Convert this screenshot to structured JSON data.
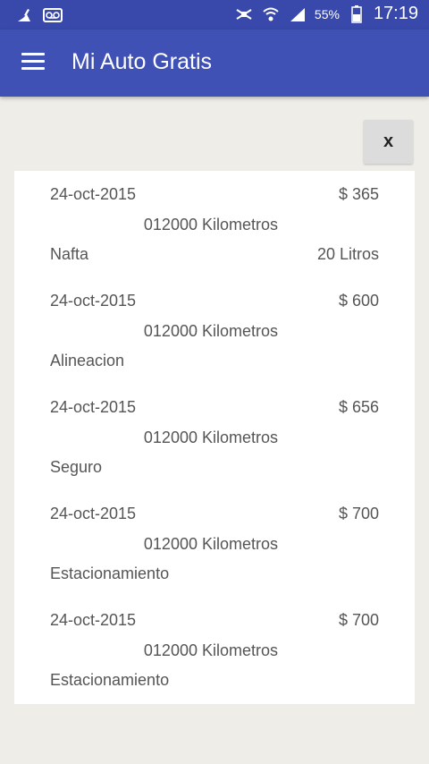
{
  "status_bar": {
    "left_icons": [
      "cleaning-icon",
      "voicemail-icon"
    ],
    "right_icons": [
      "mute-icon",
      "wifi-icon",
      "signal-icon",
      "battery-icon"
    ],
    "battery": "55%",
    "time": "17:19"
  },
  "app_bar": {
    "menu_icon": "hamburger-menu-icon",
    "title": "Mi Auto Gratis"
  },
  "close_button": {
    "label": "x"
  },
  "entries": [
    {
      "date": "24-oct-2015",
      "amount": "$ 365",
      "km": "012000 Kilometros",
      "concept": "Nafta",
      "quantity": "20 Litros"
    },
    {
      "date": "24-oct-2015",
      "amount": "$ 600",
      "km": "012000 Kilometros",
      "concept": "Alineacion",
      "quantity": ""
    },
    {
      "date": "24-oct-2015",
      "amount": "$ 656",
      "km": "012000 Kilometros",
      "concept": "Seguro",
      "quantity": ""
    },
    {
      "date": "24-oct-2015",
      "amount": "$ 700",
      "km": "012000 Kilometros",
      "concept": "Estacionamiento",
      "quantity": ""
    },
    {
      "date": "24-oct-2015",
      "amount": "$ 700",
      "km": "012000 Kilometros",
      "concept": "Estacionamiento",
      "quantity": ""
    }
  ],
  "colors": {
    "status_bar": "#3949ab",
    "app_bar": "#3f51b5",
    "background": "#eeede8",
    "card": "#ffffff",
    "text": "#555555"
  }
}
